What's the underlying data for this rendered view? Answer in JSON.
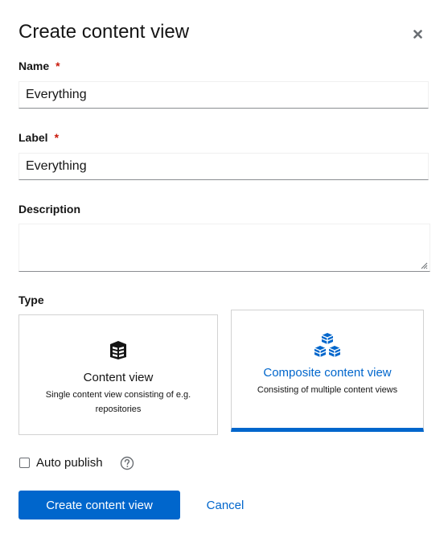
{
  "modal": {
    "title": "Create content view",
    "close_icon": "close-icon"
  },
  "form": {
    "name_label": "Name",
    "name_value": "Everything",
    "label_label": "Label",
    "label_value": "Everything",
    "required_mark": "*",
    "description_label": "Description",
    "description_value": "",
    "type_label": "Type"
  },
  "type_options": [
    {
      "title": "Content view",
      "description": "Single content view consisting of e.g. repositories",
      "icon": "content-view-icon",
      "selected": false
    },
    {
      "title": "Composite content view",
      "description": "Consisting of multiple content views",
      "icon": "composite-content-view-icon",
      "selected": true
    }
  ],
  "auto_publish": {
    "label": "Auto publish",
    "checked": false,
    "help_icon": "help-icon"
  },
  "actions": {
    "create_label": "Create content view",
    "cancel_label": "Cancel"
  },
  "colors": {
    "primary": "#0066cc",
    "required": "#c9190b",
    "text": "#151515"
  }
}
